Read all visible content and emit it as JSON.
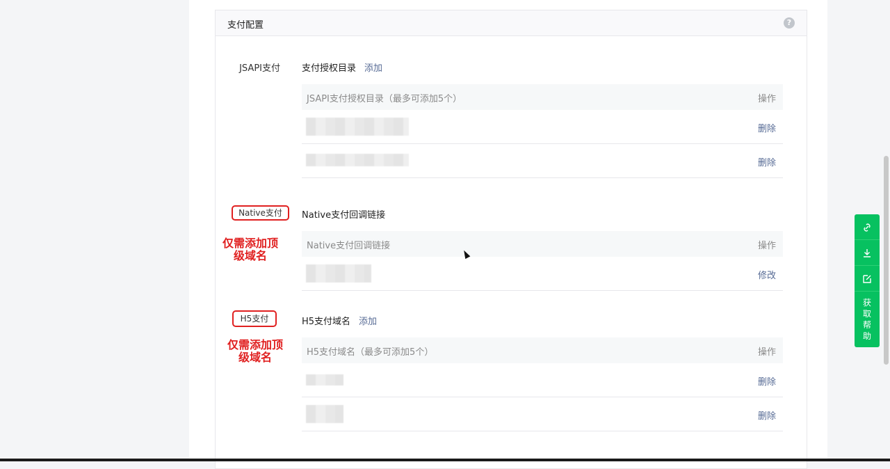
{
  "panel": {
    "title": "支付配置",
    "help_icon": "?"
  },
  "jsapi": {
    "label": "JSAPI支付",
    "section_title": "支付授权目录",
    "add_label": "添加",
    "columns": [
      "JSAPI支付授权目录（最多可添加5个）",
      "操作"
    ],
    "rows": [
      {
        "action": "删除"
      },
      {
        "action": "删除"
      }
    ]
  },
  "native": {
    "label": "Native支付",
    "section_title": "Native支付回调链接",
    "columns": [
      "Native支付回调链接",
      "操作"
    ],
    "rows": [
      {
        "action": "修改"
      }
    ],
    "annotation": "仅需添加顶级域名"
  },
  "h5": {
    "label": "H5支付",
    "section_title": "H5支付域名",
    "add_label": "添加",
    "columns": [
      "H5支付域名（最多可添加5个）",
      "操作"
    ],
    "rows": [
      {
        "action": "删除"
      },
      {
        "action": "删除"
      }
    ],
    "annotation": "仅需添加顶级域名"
  },
  "side_tools": {
    "icons": [
      "link-icon",
      "download-icon",
      "edit-icon"
    ],
    "get_help": "获取帮助"
  }
}
